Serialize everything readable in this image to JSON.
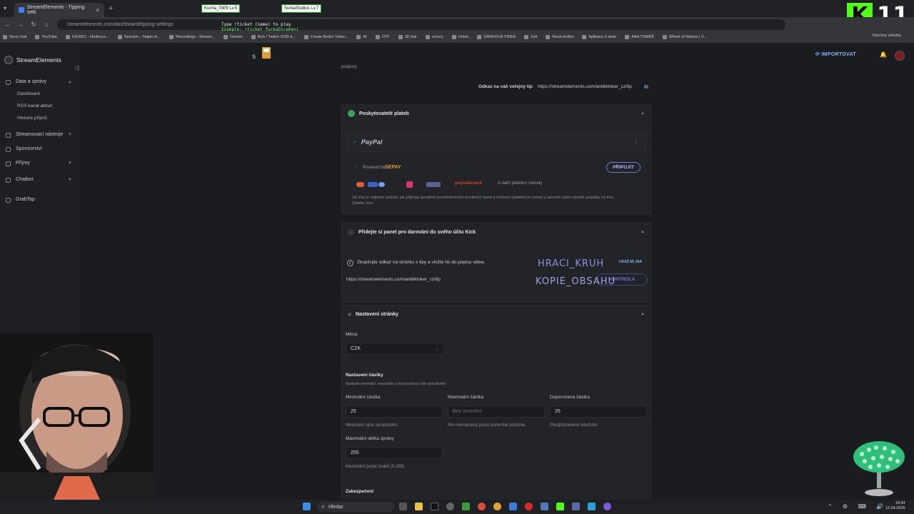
{
  "browser": {
    "tab_title": "StreamElements - Tipping setti",
    "url": "streamelements.com/dashboard/tipping-settings",
    "stream_users": [
      "Kucha_0309 Lv.5",
      "SurkaStudios Lv.7"
    ],
    "overlay_line1": "Type !ticket (name) to play",
    "overlay_line2": "Example: !ticket fuckaDicemeni",
    "bookmarks": [
      "Nový chat",
      "YouTube",
      "KZH001 - Hodnoce...",
      "Seznam – Najdu te...",
      "Recordings - Stream...",
      "Gemini",
      "Kick / Twitch VOD d...",
      "Create Better Video...",
      "AI",
      "OTF",
      "3D tisk",
      "večery",
      "Urbex",
      "DÁRKOVÁ VIDEA",
      "Grit",
      "Nová složka",
      "Aplikace 3 stran",
      "AAA TOMÁŠ",
      "Wheel of Names | V..."
    ],
    "bookmarks_right": "Všechny záložky",
    "kick_badge": "K",
    "kick_count": "11"
  },
  "sidebar": {
    "brand": "StreamElements",
    "groups": [
      {
        "label": "Data a zprávy",
        "items": [
          "Dashboard",
          "RSS kanál aktivit",
          "Historie příjmů"
        ]
      },
      {
        "label": "Streamovací nástroje"
      },
      {
        "label": "Sponzorství"
      },
      {
        "label": "Příjmy"
      },
      {
        "label": "Chatbot"
      },
      {
        "label": "GrabTap"
      }
    ]
  },
  "topbar": {
    "import_label": "IMPORTOVAT"
  },
  "main": {
    "cut_text": "podpory.",
    "public_tip_label": "Odkaz na váš veřejný tip",
    "public_tip_url": "https://streamelements.com/antitiktoker_cz/tip",
    "payment": {
      "title": "Poskytovatelé plateb",
      "paypal": "PayPal",
      "powered_by": "Powered by",
      "sepay": "SEPAY",
      "connect": "PŘIPOJIT",
      "more_methods": "A další platební metody",
      "paysafe": "paysafecard",
      "desc": "SE.Pay je nejlepší způsob, jak přijímat spropitné prostřednictvím kreditních karet a místních platebních metod a zároveň platit nejnižší poplatky na trhu.",
      "learn_more": "Zjistěte více"
    },
    "kick": {
      "title": "Přidejte si panel pro darování do svého účtu Kick",
      "instruction": "Zkopírujte odkaz na stránku s tipy a vložte ho do popisu videa.",
      "show_me": "UKAŽ MI JAK",
      "url": "https://streamelements.com/antitiktoker_cz/tip",
      "copy_button": "KONTROLA"
    },
    "watermark1": "HRACI_KRUH",
    "watermark2": "KOPIE_OBSAHU",
    "settings": {
      "title": "Nastavení stránky",
      "currency_label": "Měna",
      "currency_value": "CZK",
      "amount_title": "Nastavení částky",
      "amount_desc": "Nastavte minimální, maximální a doporučenou výši spropitného",
      "min_label": "Minimální částka",
      "min_value": "25",
      "min_hint": "Minimální výše spropitného",
      "max_label": "Maximální částka",
      "max_placeholder": "Bez omezení",
      "max_hint": "Pro neomezený počet ponechte prázdné.",
      "rec_label": "Doporučená částka",
      "rec_value": "25",
      "rec_hint": "Předpřipravené množství",
      "msglen_label": "Maximální délka zprávy",
      "msglen_value": "255",
      "msglen_hint": "Maximální počet znaků (0-255)",
      "security_title": "Zabezpečení"
    }
  },
  "taskbar": {
    "search_placeholder": "Hledat",
    "time": "18:34",
    "date": "12.04.2026"
  },
  "colors": {
    "accent": "#8ab4ff",
    "green": "#3aa55d",
    "kick": "#53fc18"
  }
}
